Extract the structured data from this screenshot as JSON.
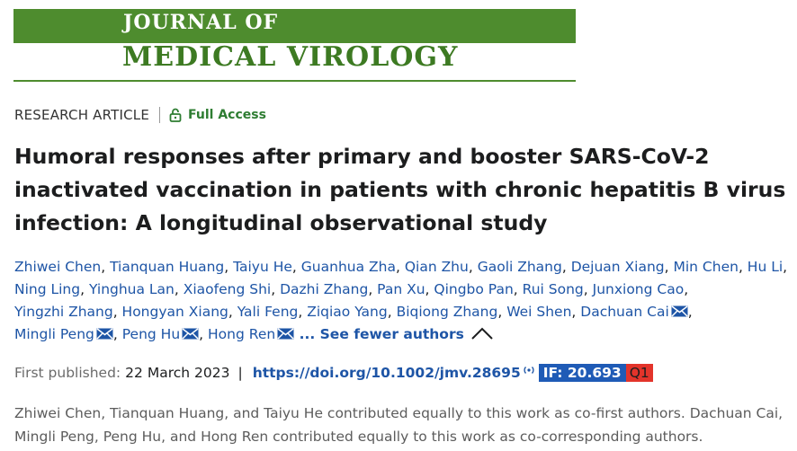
{
  "journal": {
    "name_line1": "JOURNAL OF",
    "name_line2": "MEDICAL VIROLOGY",
    "brand_color": "#4e8c2e"
  },
  "article": {
    "type": "RESEARCH ARTICLE",
    "access_icon": "lock-open-icon",
    "access_label": "Full Access",
    "title": "Humoral responses after primary and booster SARS-CoV-2 inactivated vaccination in patients with chronic hepatitis B virus infection: A longitudinal observational study"
  },
  "authors": [
    {
      "name": "Zhiwei Chen",
      "corresponding": false
    },
    {
      "name": "Tianquan Huang",
      "corresponding": false
    },
    {
      "name": "Taiyu He",
      "corresponding": false
    },
    {
      "name": "Guanhua Zha",
      "corresponding": false
    },
    {
      "name": "Qian Zhu",
      "corresponding": false
    },
    {
      "name": "Gaoli Zhang",
      "corresponding": false
    },
    {
      "name": "Dejuan Xiang",
      "corresponding": false
    },
    {
      "name": "Min Chen",
      "corresponding": false
    },
    {
      "name": "Hu Li",
      "corresponding": false
    },
    {
      "name": "Ning Ling",
      "corresponding": false
    },
    {
      "name": "Yinghua Lan",
      "corresponding": false
    },
    {
      "name": "Xiaofeng Shi",
      "corresponding": false
    },
    {
      "name": "Dazhi Zhang",
      "corresponding": false
    },
    {
      "name": "Pan Xu",
      "corresponding": false
    },
    {
      "name": "Qingbo Pan",
      "corresponding": false
    },
    {
      "name": "Rui Song",
      "corresponding": false
    },
    {
      "name": "Junxiong Cao",
      "corresponding": false
    },
    {
      "name": "Yingzhi Zhang",
      "corresponding": false
    },
    {
      "name": "Hongyan Xiang",
      "corresponding": false
    },
    {
      "name": "Yali Feng",
      "corresponding": false
    },
    {
      "name": "Ziqiao Yang",
      "corresponding": false
    },
    {
      "name": "Biqiong Zhang",
      "corresponding": false
    },
    {
      "name": "Wei Shen",
      "corresponding": false
    },
    {
      "name": "Dachuan Cai",
      "corresponding": true
    },
    {
      "name": "Mingli Peng",
      "corresponding": true
    },
    {
      "name": "Peng Hu",
      "corresponding": true
    },
    {
      "name": "Hong Ren",
      "corresponding": true
    }
  ],
  "authors_toggle": {
    "label": "... See fewer authors",
    "icon": "chevron-up-icon"
  },
  "publication": {
    "first_published_label": "First published:",
    "date": "22 March 2023",
    "separator": "|",
    "doi": "https://doi.org/10.1002/jmv.28695",
    "impact_factor": "IF: 20.693",
    "quartile": "Q1",
    "if_color": "#1f5bb6",
    "quartile_color": "#e3342b"
  },
  "contribution_note": "Zhiwei Chen, Tianquan Huang, and Taiyu He contributed equally to this work as co-first authors. Dachuan Cai, Mingli Peng, Peng Hu, and Hong Ren contributed equally to this work as co-corresponding authors."
}
